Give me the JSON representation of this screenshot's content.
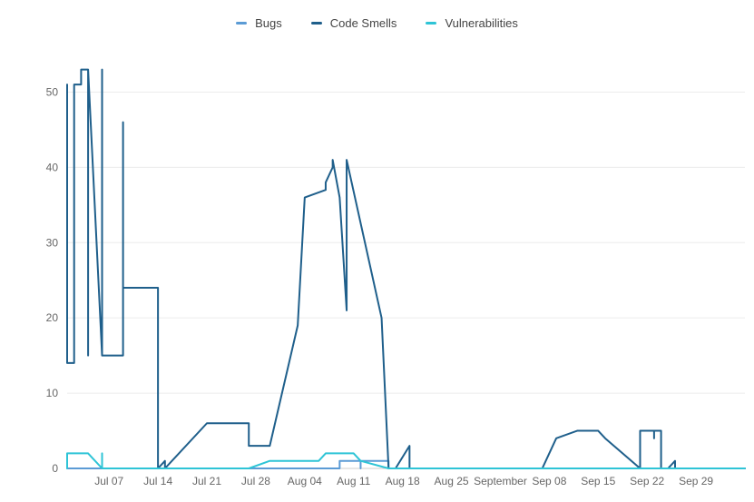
{
  "chart_data": {
    "type": "line",
    "title": "",
    "xlabel": "",
    "ylabel": "",
    "ylim": [
      0,
      55
    ],
    "y_ticks": [
      0,
      10,
      20,
      30,
      40,
      50
    ],
    "x_range": [
      "2024-07-01",
      "2024-10-06"
    ],
    "x_ticks": [
      {
        "date": "2024-07-07",
        "label": "Jul 07"
      },
      {
        "date": "2024-07-14",
        "label": "Jul 14"
      },
      {
        "date": "2024-07-21",
        "label": "Jul 21"
      },
      {
        "date": "2024-07-28",
        "label": "Jul 28"
      },
      {
        "date": "2024-08-04",
        "label": "Aug 04"
      },
      {
        "date": "2024-08-11",
        "label": "Aug 11"
      },
      {
        "date": "2024-08-18",
        "label": "Aug 18"
      },
      {
        "date": "2024-08-25",
        "label": "Aug 25"
      },
      {
        "date": "2024-09-01",
        "label": "September"
      },
      {
        "date": "2024-09-08",
        "label": "Sep 08"
      },
      {
        "date": "2024-09-15",
        "label": "Sep 15"
      },
      {
        "date": "2024-09-22",
        "label": "Sep 22"
      },
      {
        "date": "2024-09-29",
        "label": "Sep 29"
      }
    ],
    "grid": "horizontal",
    "legend_position": "top-center",
    "series": [
      {
        "name": "Bugs",
        "color": "#5b9bd5",
        "points": [
          [
            "2024-07-01",
            0
          ],
          [
            "2024-08-09",
            0
          ],
          [
            "2024-08-09",
            1
          ],
          [
            "2024-08-12",
            1
          ],
          [
            "2024-08-12",
            0
          ],
          [
            "2024-08-12",
            1
          ],
          [
            "2024-08-16",
            1
          ],
          [
            "2024-08-16",
            0
          ],
          [
            "2024-10-06",
            0
          ]
        ]
      },
      {
        "name": "Code Smells",
        "color": "#1f5f8b",
        "points": [
          [
            "2024-07-01",
            51
          ],
          [
            "2024-07-01",
            14
          ],
          [
            "2024-07-02",
            14
          ],
          [
            "2024-07-02",
            51
          ],
          [
            "2024-07-03",
            51
          ],
          [
            "2024-07-03",
            53
          ],
          [
            "2024-07-04",
            53
          ],
          [
            "2024-07-04",
            15
          ],
          [
            "2024-07-04",
            53
          ],
          [
            "2024-07-06",
            15
          ],
          [
            "2024-07-06",
            53
          ],
          [
            "2024-07-06",
            15
          ],
          [
            "2024-07-07",
            15
          ],
          [
            "2024-07-09",
            15
          ],
          [
            "2024-07-09",
            46
          ],
          [
            "2024-07-09",
            24
          ],
          [
            "2024-07-14",
            24
          ],
          [
            "2024-07-14",
            4
          ],
          [
            "2024-07-14",
            0
          ],
          [
            "2024-07-15",
            1
          ],
          [
            "2024-07-15",
            0
          ],
          [
            "2024-07-21",
            6
          ],
          [
            "2024-07-27",
            6
          ],
          [
            "2024-07-27",
            3
          ],
          [
            "2024-07-30",
            3
          ],
          [
            "2024-08-03",
            19
          ],
          [
            "2024-08-04",
            36
          ],
          [
            "2024-08-07",
            37
          ],
          [
            "2024-08-07",
            38
          ],
          [
            "2024-08-08",
            40
          ],
          [
            "2024-08-08",
            41
          ],
          [
            "2024-08-09",
            36
          ],
          [
            "2024-08-10",
            21
          ],
          [
            "2024-08-10",
            41
          ],
          [
            "2024-08-15",
            20
          ],
          [
            "2024-08-16",
            0
          ],
          [
            "2024-08-17",
            0
          ],
          [
            "2024-08-19",
            3
          ],
          [
            "2024-08-19",
            0
          ],
          [
            "2024-09-07",
            0
          ],
          [
            "2024-09-09",
            4
          ],
          [
            "2024-09-12",
            5
          ],
          [
            "2024-09-15",
            5
          ],
          [
            "2024-09-16",
            4
          ],
          [
            "2024-09-21",
            0
          ],
          [
            "2024-09-21",
            5
          ],
          [
            "2024-09-23",
            5
          ],
          [
            "2024-09-23",
            4
          ],
          [
            "2024-09-23",
            5
          ],
          [
            "2024-09-24",
            5
          ],
          [
            "2024-09-24",
            0
          ],
          [
            "2024-09-25",
            0
          ],
          [
            "2024-09-26",
            1
          ],
          [
            "2024-09-26",
            0
          ],
          [
            "2024-10-06",
            0
          ]
        ]
      },
      {
        "name": "Vulnerabilities",
        "color": "#2ec4d6",
        "points": [
          [
            "2024-07-01",
            2
          ],
          [
            "2024-07-01",
            0
          ],
          [
            "2024-07-01",
            2
          ],
          [
            "2024-07-04",
            2
          ],
          [
            "2024-07-06",
            0
          ],
          [
            "2024-07-06",
            2
          ],
          [
            "2024-07-06",
            0
          ],
          [
            "2024-07-27",
            0
          ],
          [
            "2024-07-30",
            1
          ],
          [
            "2024-08-06",
            1
          ],
          [
            "2024-08-07",
            2
          ],
          [
            "2024-08-11",
            2
          ],
          [
            "2024-08-12",
            1
          ],
          [
            "2024-08-16",
            0
          ],
          [
            "2024-10-06",
            0
          ]
        ]
      }
    ]
  }
}
